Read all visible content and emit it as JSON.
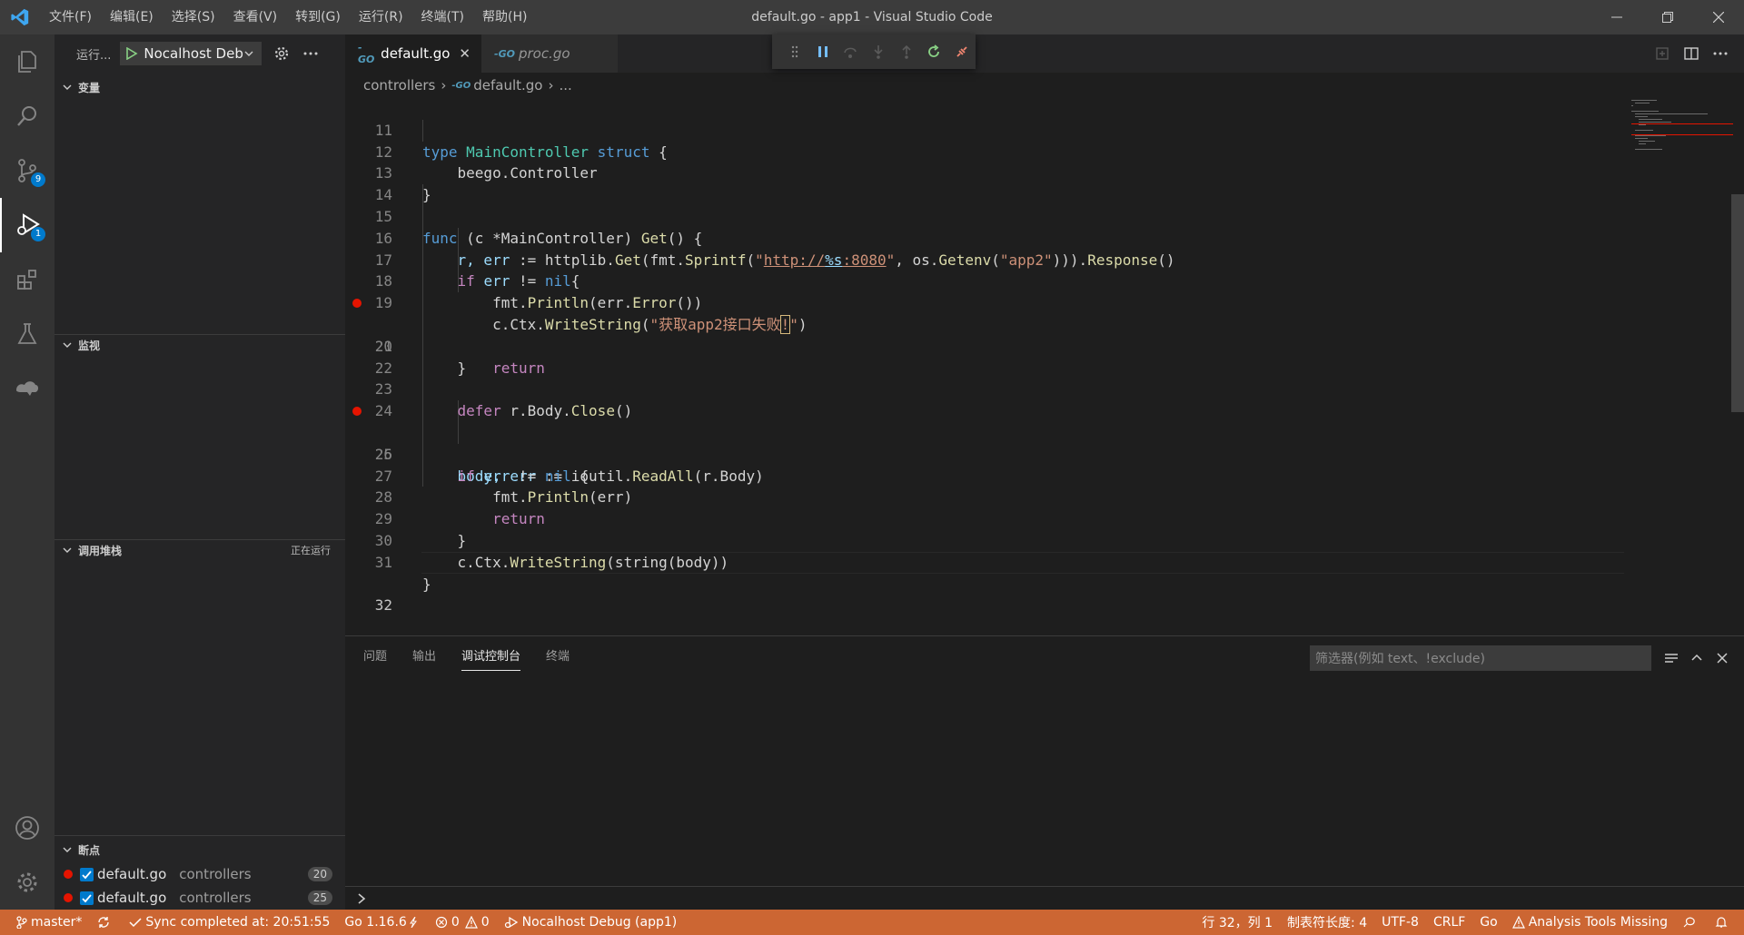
{
  "window": {
    "title": "default.go - app1 - Visual Studio Code",
    "menu": [
      "文件(F)",
      "编辑(E)",
      "选择(S)",
      "查看(V)",
      "转到(G)",
      "运行(R)",
      "终端(T)",
      "帮助(H)"
    ]
  },
  "activity": {
    "source_control_badge": "9",
    "debug_badge": "1"
  },
  "sidebar": {
    "run_label": "运行...",
    "debug_config": "Nocalhost Debug (app1)",
    "sections": {
      "variables": "变量",
      "watch": "监视",
      "callstack": "调用堆栈",
      "callstack_status": "正在运行",
      "breakpoints": "断点"
    },
    "breakpoints": [
      {
        "file": "default.go",
        "dir": "controllers",
        "line": "20",
        "checked": true
      },
      {
        "file": "default.go",
        "dir": "controllers",
        "line": "25",
        "checked": true
      }
    ]
  },
  "editor": {
    "tabs": [
      {
        "label": "default.go",
        "active": true
      },
      {
        "label": "proc.go",
        "active": false
      }
    ],
    "breadcrumb": [
      "controllers",
      "default.go",
      "..."
    ],
    "line_numbers": [
      "11",
      "12",
      "13",
      "14",
      "15",
      "16",
      "17",
      "18",
      "19",
      "20",
      "21",
      "22",
      "23",
      "24",
      "25",
      "26",
      "27",
      "28",
      "29",
      "30",
      "31",
      "32"
    ],
    "current_line": "32",
    "breakpoint_lines": [
      "20",
      "25"
    ],
    "code": {
      "l11": [
        "type",
        "MainController",
        "struct",
        "{"
      ],
      "l12": "beego.Controller",
      "l13": "}",
      "l15": [
        "func",
        "(c *MainController)",
        "Get",
        "() {"
      ],
      "l16": [
        "r, err",
        ":=",
        "httplib.",
        "Get",
        "(fmt.",
        "Sprintf",
        "(",
        "\"",
        "http://",
        "%s",
        ":8080",
        "\"",
        ", os.",
        "Getenv",
        "(",
        "\"app2\"",
        "))).",
        "Response",
        "()"
      ],
      "l17": [
        "if",
        "err",
        "!=",
        "nil",
        "{"
      ],
      "l18": [
        "fmt.",
        "Println",
        "(err.",
        "Error",
        "())"
      ],
      "l19": [
        "c.Ctx.",
        "WriteString",
        "(",
        "\"获取app2接口失败",
        "!",
        "\"",
        ")"
      ],
      "l20": "return",
      "l21": "}",
      "l23": [
        "defer",
        "r.Body.",
        "Close",
        "()"
      ],
      "l25": [
        "body, err",
        ":=",
        "ioutil.",
        "ReadAll",
        "(r.Body)"
      ],
      "l26": [
        "if",
        "err",
        "!=",
        "nil",
        "{"
      ],
      "l27": [
        "fmt.",
        "Println",
        "(err)"
      ],
      "l28": "return",
      "l29": "}",
      "l30": [
        "c.Ctx.",
        "WriteString",
        "(string(body))"
      ],
      "l31": "}"
    }
  },
  "panel": {
    "tabs": [
      "问题",
      "输出",
      "调试控制台",
      "终端"
    ],
    "active_tab": "调试控制台",
    "filter_placeholder": "筛选器(例如 text、!exclude)"
  },
  "statusbar": {
    "branch": "master*",
    "sync": "Sync completed at: 20:51:55",
    "go_version": "Go 1.16.6",
    "errors": "0",
    "warnings": "0",
    "debug_session": "Nocalhost Debug (app1)",
    "position": "行 32，列 1",
    "tab_size": "制表符长度: 4",
    "encoding": "UTF-8",
    "eol": "CRLF",
    "language": "Go",
    "analysis": "Analysis Tools Missing",
    "color": "#cc6633"
  }
}
